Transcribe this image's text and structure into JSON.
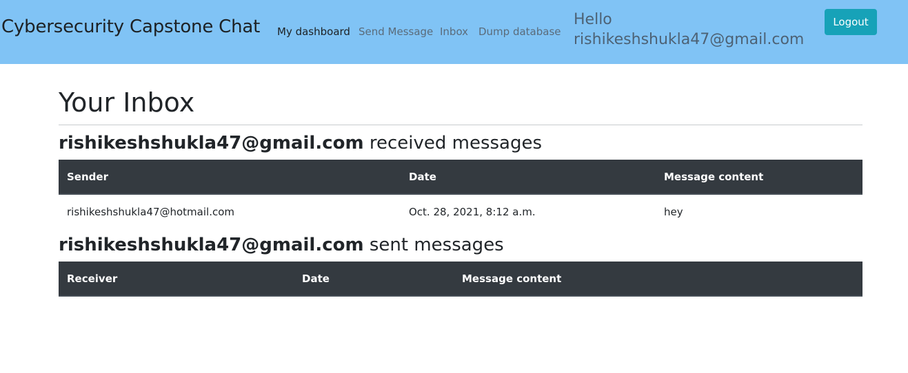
{
  "navbar": {
    "brand": "Cybersecurity Capstone Chat",
    "links": [
      "My dashboard",
      "Send Message",
      "Inbox",
      "Dump database"
    ],
    "greeting_line1": "Hello",
    "greeting_line2": "rishikeshshukla47@gmail.com",
    "logout_label": "Logout"
  },
  "page": {
    "title": "Your Inbox"
  },
  "received": {
    "user": "rishikeshshukla47@gmail.com",
    "suffix": " received messages",
    "columns": [
      "Sender",
      "Date",
      "Message content"
    ],
    "rows": [
      {
        "sender": "rishikeshshukla47@hotmail.com",
        "date": "Oct. 28, 2021, 8:12 a.m.",
        "content": "hey"
      }
    ]
  },
  "sent": {
    "user": "rishikeshshukla47@gmail.com",
    "suffix": " sent messages",
    "columns": [
      "Receiver",
      "Date",
      "Message content"
    ],
    "rows": []
  },
  "colors": {
    "navbar_bg": "#80c3f5",
    "logout_bg": "#17a2b8",
    "table_header_bg": "#343a40"
  }
}
